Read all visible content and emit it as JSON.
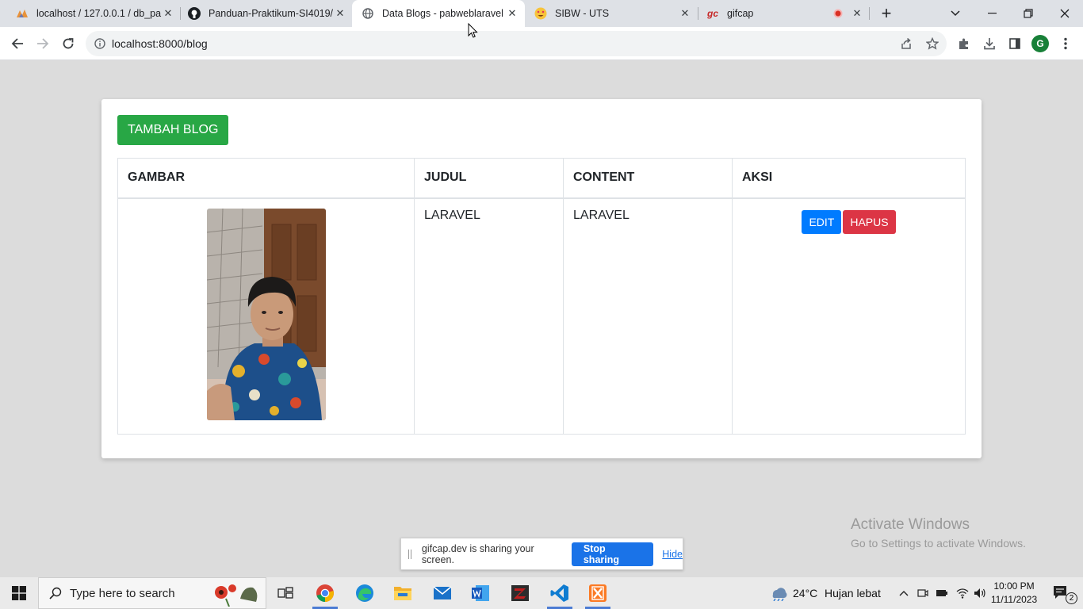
{
  "browser": {
    "tabs": [
      {
        "title": "localhost / 127.0.0.1 / db_pa",
        "icon": "phpmyadmin-icon",
        "active": false
      },
      {
        "title": "Panduan-Praktikum-SI4019/",
        "icon": "github-icon",
        "active": false
      },
      {
        "title": "Data Blogs - pabweblaravel",
        "icon": "globe-icon",
        "active": true
      },
      {
        "title": "SIBW - UTS",
        "icon": "emoji-icon",
        "active": false
      },
      {
        "title": "gifcap",
        "icon": "gifcap-icon",
        "active": false,
        "recording": true
      }
    ],
    "url": "localhost:8000/blog",
    "profile_initial": "G"
  },
  "page": {
    "add_button": "TAMBAH BLOG",
    "table": {
      "headers": [
        "GAMBAR",
        "JUDUL",
        "CONTENT",
        "AKSI"
      ],
      "rows": [
        {
          "judul": "LARAVEL",
          "content": "LARAVEL",
          "edit": "EDIT",
          "hapus": "HAPUS"
        }
      ]
    }
  },
  "overlay": {
    "activate_title": "Activate Windows",
    "activate_sub": "Go to Settings to activate Windows.",
    "share_message": "gifcap.dev is sharing your screen.",
    "stop_sharing": "Stop sharing",
    "hide": "Hide"
  },
  "taskbar": {
    "search_placeholder": "Type here to search",
    "weather_temp": "24°C",
    "weather_desc": "Hujan lebat",
    "time": "10:00 PM",
    "date": "11/11/2023",
    "notification_count": "2"
  },
  "colors": {
    "add_button": "#28a745",
    "edit_button": "#007bff",
    "delete_button": "#dc3545",
    "stop_sharing": "#1a73e8"
  }
}
